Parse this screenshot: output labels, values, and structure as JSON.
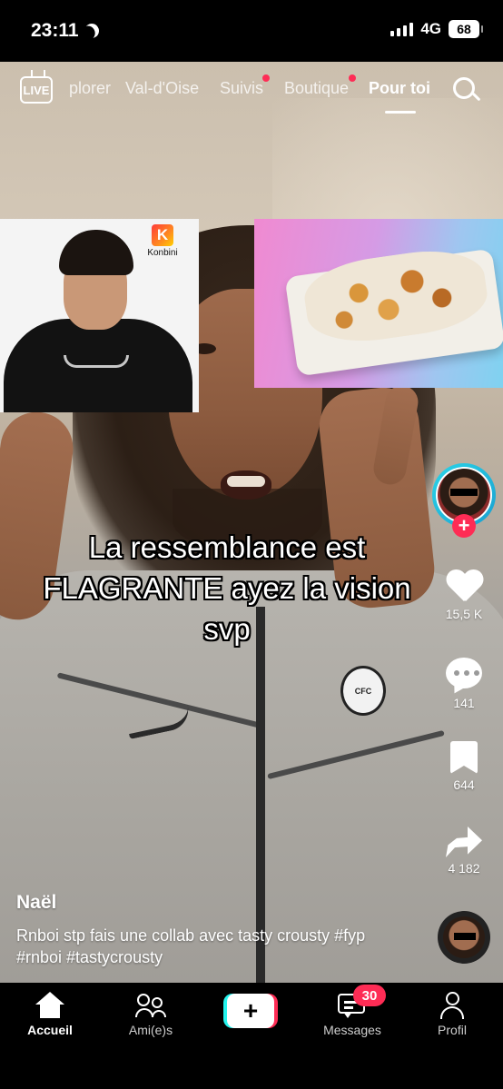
{
  "status_bar": {
    "time": "23:11",
    "network": "4G",
    "battery": "68"
  },
  "top_nav": {
    "live_label": "LIVE",
    "tabs": [
      {
        "label": "plorer",
        "active": false
      },
      {
        "label": "Val-d'Oise",
        "active": false
      },
      {
        "label": "Suivis",
        "active": false,
        "dot": true
      },
      {
        "label": "Boutique",
        "active": false,
        "dot": true
      },
      {
        "label": "Pour toi",
        "active": true
      }
    ]
  },
  "overlay": {
    "konbini_label": "Konbini",
    "konbini_mark": "K",
    "caption_lines": [
      "La ressemblance est",
      "FLAGRANTE ayez la vision",
      "svp"
    ]
  },
  "actions": {
    "likes": "15,5 K",
    "comments": "141",
    "saves": "644",
    "shares": "4 182"
  },
  "post": {
    "username": "Naël",
    "description": "Rnboi stp fais une collab avec tasty crousty #fyp #rnboi #tastycrousty"
  },
  "bottom_nav": {
    "items": [
      {
        "label": "Accueil",
        "active": true
      },
      {
        "label": "Ami(e)s",
        "active": false
      },
      {
        "label": "Messages",
        "active": false
      },
      {
        "label": "Profil",
        "active": false
      }
    ],
    "create_label": "+",
    "messages_badge": "30"
  },
  "colors": {
    "accent_red": "#fe2c55",
    "accent_cyan": "#25f4ee"
  }
}
